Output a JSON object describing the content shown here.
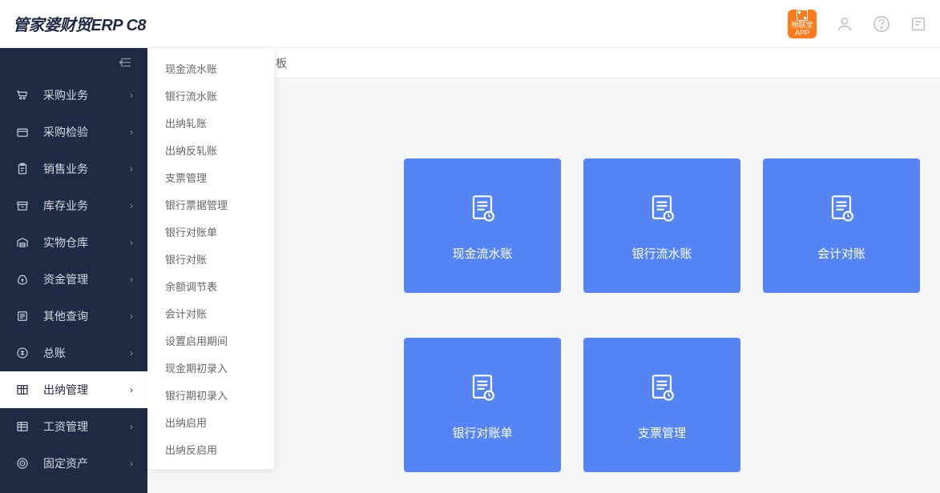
{
  "header": {
    "logo_main": "管家婆",
    "logo_sub": "财贸ERP",
    "logo_ver": "C8",
    "app_badge": "物联宝\nAPP"
  },
  "breadcrumb": "板",
  "sidebar": {
    "items": [
      {
        "label": "采购业务",
        "icon": "cart"
      },
      {
        "label": "采购检验",
        "icon": "box"
      },
      {
        "label": "销售业务",
        "icon": "clipboard"
      },
      {
        "label": "库存业务",
        "icon": "archive"
      },
      {
        "label": "实物仓库",
        "icon": "warehouse"
      },
      {
        "label": "资金管理",
        "icon": "moneybag"
      },
      {
        "label": "其他查询",
        "icon": "list"
      },
      {
        "label": "总账",
        "icon": "coin"
      },
      {
        "label": "出纳管理",
        "icon": "grid",
        "active": true
      },
      {
        "label": "工资管理",
        "icon": "table"
      },
      {
        "label": "固定资产",
        "icon": "target"
      }
    ]
  },
  "submenu": [
    "现金流水账",
    "银行流水账",
    "出纳轧账",
    "出纳反轧账",
    "支票管理",
    "银行票据管理",
    "银行对账单",
    "银行对账",
    "余额调节表",
    "会计对账",
    "设置启用期间",
    "现金期初录入",
    "银行期初录入",
    "出纳启用",
    "出纳反启用"
  ],
  "cards": [
    {
      "label": "现金流水账"
    },
    {
      "label": "银行流水账"
    },
    {
      "label": "会计对账"
    },
    {
      "label": "银行对账单"
    },
    {
      "label": "支票管理"
    }
  ]
}
